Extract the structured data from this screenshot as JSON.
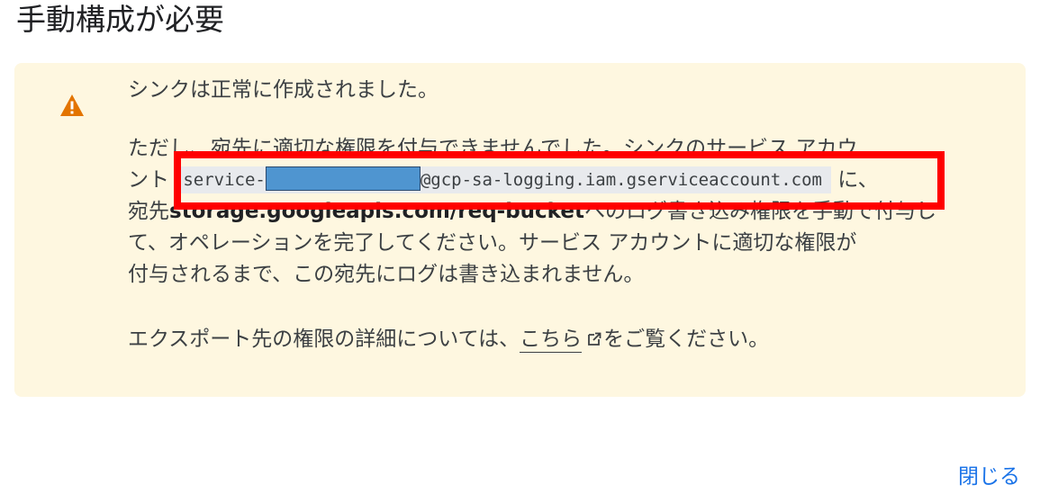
{
  "dialog": {
    "title": "手動構成が必要",
    "close_label": "閉じる"
  },
  "warning": {
    "icon": "warning-icon",
    "message1": "シンクは正常に作成されました。",
    "line1": "ただし、宛先に適切な権限を付与できませんでした。シンクのサービス アカウ",
    "line2_prefix": "ント",
    "service_account_prefix": "service-",
    "service_account_suffix": "@gcp-sa-logging.iam.gserviceaccount.com",
    "line2_suffix": "に、",
    "line3_prefix": "宛先",
    "destination": "storage.googleapis.com/req-bucket",
    "line3_suffix": "へのログ書き込み権限を手動で付与し",
    "line4": "て、オペレーションを完了してください。サービス アカウントに適切な権限が",
    "line5": "付与されるまで、この宛先にログは書き込まれません。",
    "msg3_prefix": "エクスポート先の権限の詳細については、",
    "link_text": "こちら",
    "msg3_suffix": "をご覧ください。"
  },
  "colors": {
    "warning_bg": "#fef7e0",
    "warning_icon": "#e37400",
    "link_blue": "#1a73e8",
    "highlight_red": "#ff0000",
    "redaction_blue": "#4f95d0"
  }
}
